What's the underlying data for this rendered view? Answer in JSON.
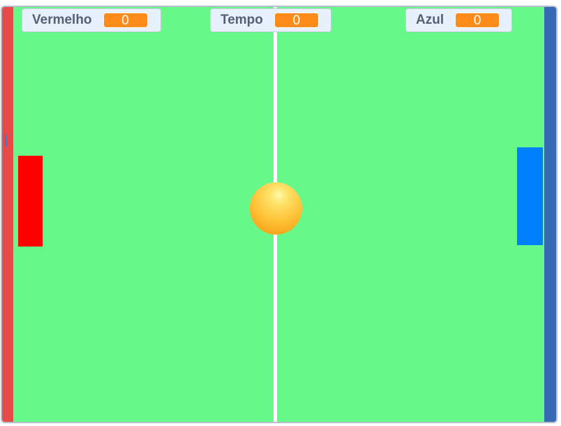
{
  "monitors": {
    "red": {
      "label": "Vermelho",
      "value": "0"
    },
    "time": {
      "label": "Tempo",
      "value": "0"
    },
    "blue": {
      "label": "Azul",
      "value": "0"
    }
  },
  "colors": {
    "field": "#66f888",
    "left_wall": "#e84a4a",
    "right_wall": "#3569b6",
    "red_paddle": "#ff0000",
    "blue_paddle": "#0080ff",
    "ball": "#ffc53a",
    "monitor_value": "#ff8c1a"
  }
}
